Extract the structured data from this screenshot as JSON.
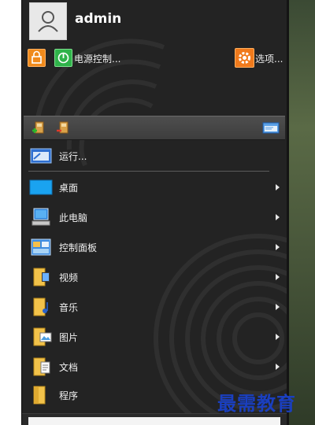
{
  "user": {
    "name": "admin"
  },
  "top_row": {
    "lock_icon": "lock-icon",
    "power_label": "电源控制...",
    "options_label": "选项..."
  },
  "toolbar": {
    "add_icon": "add-shortcut-icon",
    "remove_icon": "remove-shortcut-icon",
    "window_icon": "window-icon"
  },
  "run": {
    "label": "运行..."
  },
  "menu_items": [
    {
      "label": "桌面",
      "icon": "desktop-icon",
      "submenu": true
    },
    {
      "label": "此电脑",
      "icon": "computer-icon",
      "submenu": true
    },
    {
      "label": "控制面板",
      "icon": "control-panel-icon",
      "submenu": true
    },
    {
      "label": "视频",
      "icon": "video-folder-icon",
      "submenu": true
    },
    {
      "label": "音乐",
      "icon": "music-folder-icon",
      "submenu": true
    },
    {
      "label": "图片",
      "icon": "pictures-folder-icon",
      "submenu": true
    },
    {
      "label": "文档",
      "icon": "documents-folder-icon",
      "submenu": true
    },
    {
      "label": "程序",
      "icon": "programs-folder-icon",
      "submenu": false
    }
  ],
  "watermark": "最需教育",
  "colors": {
    "menu_bg": "#232323",
    "lock_orange": "#f08a1c",
    "power_green": "#2fb34a",
    "options_orange": "#f07a1c",
    "watermark_blue": "#1a3fbf"
  }
}
